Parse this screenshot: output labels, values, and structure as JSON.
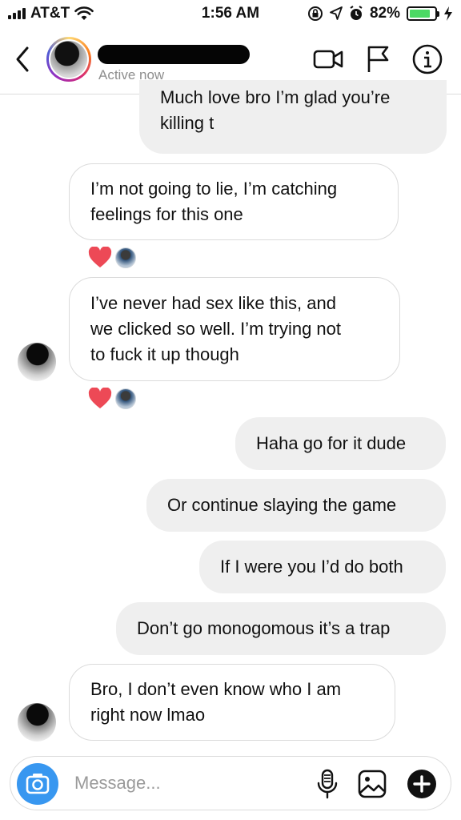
{
  "status_bar": {
    "carrier": "AT&T",
    "time": "1:56 AM",
    "battery": "82%",
    "battery_level": 0.82
  },
  "header": {
    "status": "Active now",
    "icons": [
      "back-chevron-icon",
      "video-call-icon",
      "flag-icon",
      "info-icon"
    ]
  },
  "messages": [
    {
      "from": "me",
      "text": "Much love bro I’m glad you’re\nkilling t"
    },
    {
      "from": "them",
      "text": "I’m not going to lie, I’m catching\nfeelings for this one"
    },
    {
      "from": "them",
      "text": "I’ve never had sex like this, and\nwe clicked so well. I’m trying not\nto fuck it up though"
    },
    {
      "from": "me",
      "text": "Haha go for it dude"
    },
    {
      "from": "me",
      "text": "Or continue slaying the game"
    },
    {
      "from": "me",
      "text": "If I were you I’d do both"
    },
    {
      "from": "me",
      "text": "Don’t go monogomous it’s a trap"
    },
    {
      "from": "them",
      "text": "Bro, I don’t even know who I am\nright now lmao"
    }
  ],
  "composer": {
    "placeholder": "Message...",
    "icons": [
      "camera-icon",
      "microphone-icon",
      "gallery-icon",
      "add-icon"
    ]
  },
  "colors": {
    "sent_bubble": "#efefef",
    "received_border": "#dbdbdb",
    "camera_button": "#3897f0",
    "heart": "#ed4956",
    "battery_fill": "#4cd964"
  }
}
